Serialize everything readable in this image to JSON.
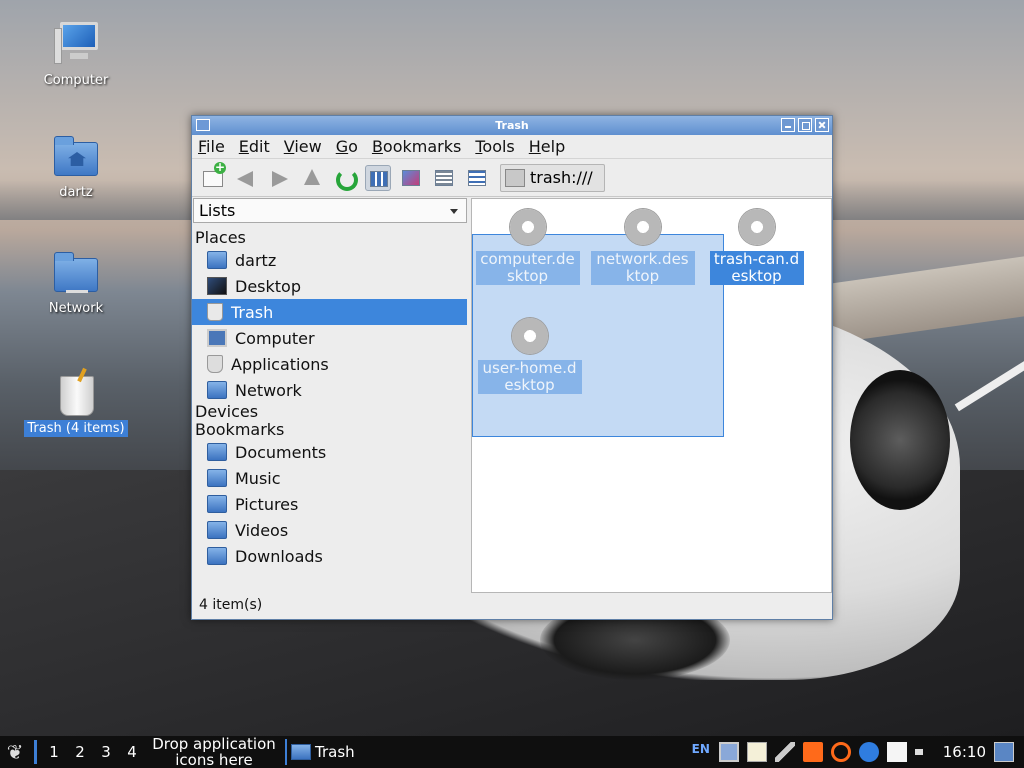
{
  "desktop": {
    "icons": [
      {
        "label": "Computer"
      },
      {
        "label": "dartz"
      },
      {
        "label": "Network"
      },
      {
        "label": "Trash (4 items)"
      }
    ]
  },
  "window": {
    "title": "Trash",
    "menu": [
      "File",
      "Edit",
      "View",
      "Go",
      "Bookmarks",
      "Tools",
      "Help"
    ],
    "location": "trash:///",
    "sidebar": {
      "mode": "Lists",
      "places_header": "Places",
      "places": [
        "dartz",
        "Desktop",
        "Trash",
        "Computer",
        "Applications",
        "Network"
      ],
      "devices_header": "Devices",
      "bookmarks_header": "Bookmarks",
      "bookmarks": [
        "Documents",
        "Music",
        "Pictures",
        "Videos",
        "Downloads"
      ]
    },
    "files": [
      "computer.desktop",
      "network.desktop",
      "trash-can.desktop",
      "user-home.desktop"
    ],
    "status": "4 item(s)"
  },
  "taskbar": {
    "desktops": [
      "1",
      "2",
      "3",
      "4"
    ],
    "launcher_hint": "Drop application icons here",
    "task": "Trash",
    "lang": "EN",
    "clock": "16:10"
  },
  "colors": {
    "selection": "#3d86dc",
    "titlebar": "#6f9bd9",
    "taskbar": "#0f0f0f"
  }
}
